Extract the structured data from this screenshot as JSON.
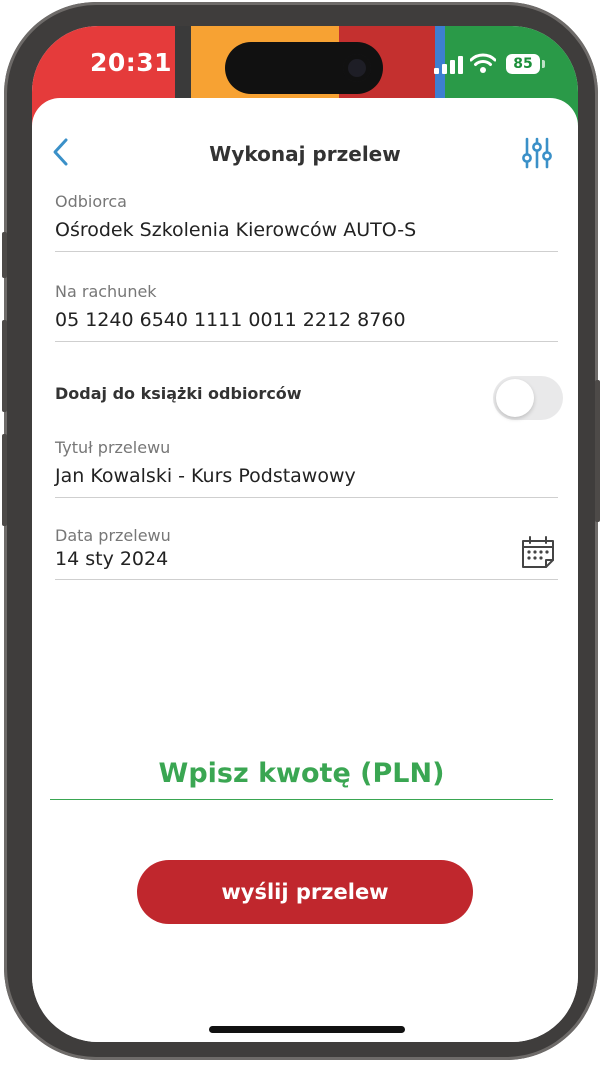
{
  "status_bar": {
    "time": "20:31",
    "battery": "85",
    "stripe_colors": [
      "#e53b3b",
      "#3a3a3a",
      "#f7a233",
      "#c4302f",
      "#3d7fd1",
      "#2a9a48"
    ]
  },
  "header": {
    "title": "Wykonaj przelew",
    "back_icon": "chevron-left-icon",
    "filter_icon": "sliders-icon",
    "accent_color": "#3a90c8"
  },
  "form": {
    "recipient": {
      "label": "Odbiorca",
      "value": "Ośrodek Szkolenia Kierowców AUTO-S"
    },
    "account": {
      "label": "Na rachunek",
      "value": "05 1240 6540 1111 0011 2212 8760"
    },
    "add_to_book": {
      "label": "Dodaj do książki odbiorców",
      "enabled": false
    },
    "transfer_title": {
      "label": "Tytuł przelewu",
      "value": "Jan Kowalski - Kurs Podstawowy"
    },
    "transfer_date": {
      "label": "Data przelewu",
      "value": "14 sty 2024",
      "icon": "calendar-icon"
    }
  },
  "amount": {
    "placeholder": "Wpisz kwotę (PLN)",
    "color": "#3aa652"
  },
  "submit": {
    "label": "wyślij przelew",
    "color": "#c0272d"
  }
}
